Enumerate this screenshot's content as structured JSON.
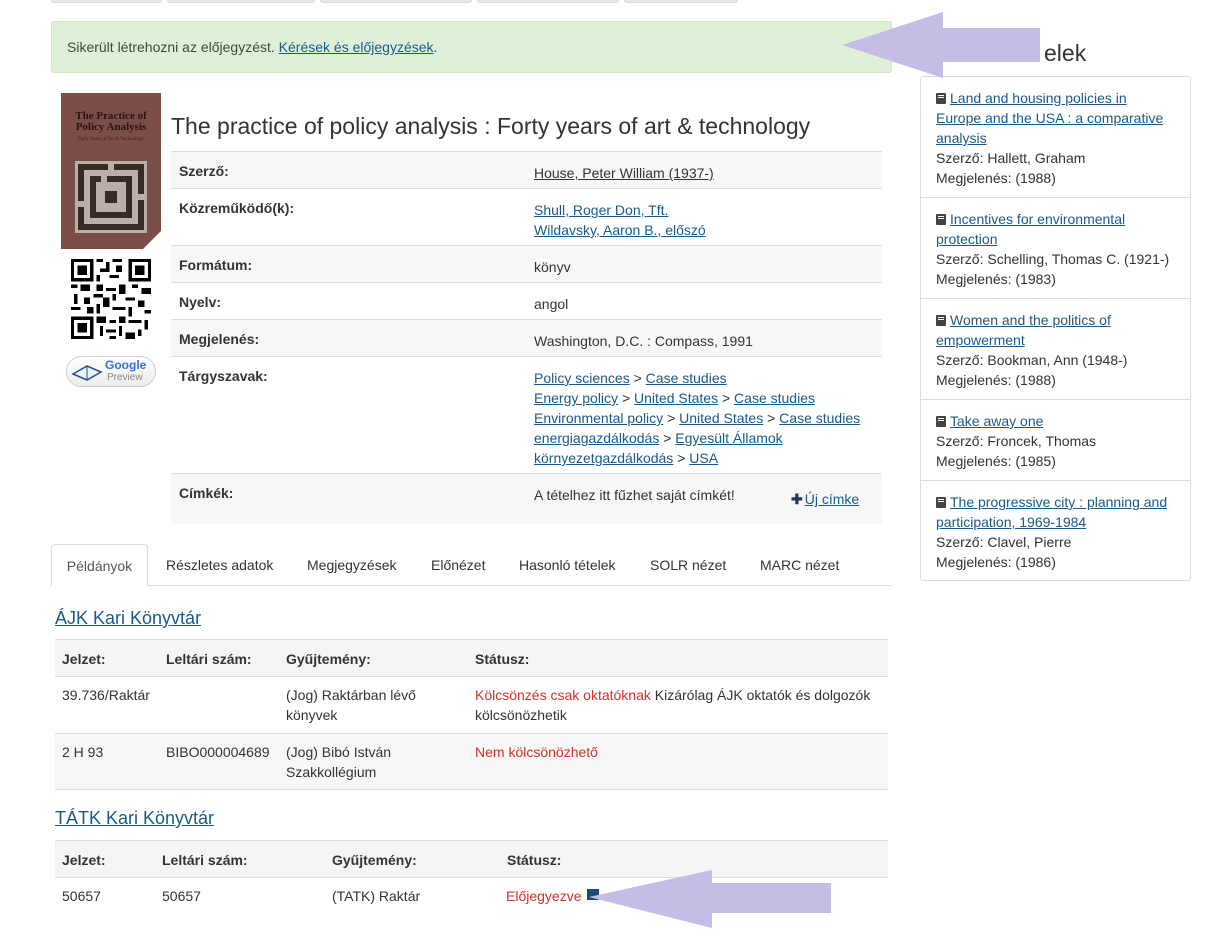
{
  "alert": {
    "message": "Sikerült létrehozni az előjegyzést.",
    "link": "Kérések és előjegyzések",
    "suffix": "."
  },
  "cover": {
    "title": "The Practice of Policy Analysis",
    "subtitle": "Forty Years of Art & Technology"
  },
  "google_preview": {
    "line1": "Google",
    "line2": "Preview"
  },
  "record": {
    "title": "The practice of policy analysis : Forty years of art & technology",
    "labels": {
      "author": "Szerző:",
      "contributors": "Közreműködő(k):",
      "format": "Formátum:",
      "language": "Nyelv:",
      "published": "Megjelenés:",
      "subjects": "Tárgyszavak:",
      "tags": "Címkék:"
    },
    "author": "House, Peter William (1937-)",
    "contributors": [
      "Shull, Roger Don, Tft.",
      "Wildavsky, Aaron B., előszó"
    ],
    "format": "könyv",
    "language": "angol",
    "published": "Washington, D.C. : Compass, 1991",
    "subjects": [
      [
        "Policy sciences",
        "Case studies"
      ],
      [
        "Energy policy",
        "United States",
        "Case studies"
      ],
      [
        "Environmental policy",
        "United States",
        "Case studies"
      ],
      [
        "energiagazdálkodás",
        "Egyesült Államok"
      ],
      [
        "környezetgazdálkodás",
        "USA"
      ]
    ],
    "subject_separator": ">",
    "tags_text": "A tételhez itt fűzhet saját címkét!",
    "new_tag": "Új címke"
  },
  "tabs": [
    "Példányok",
    "Részletes adatok",
    "Megjegyzések",
    "Előnézet",
    "Hasonló tételek",
    "SOLR nézet",
    "MARC nézet"
  ],
  "holdings": [
    {
      "library": "ÁJK Kari Könyvtár",
      "headers": [
        "Jelzet:",
        "Leltári szám:",
        "Gyűjtemény:",
        "Státusz:"
      ],
      "rows": [
        {
          "call_number": "39.736/Raktár",
          "inventory": "",
          "collection": "(Jog) Raktárban lévő könyvek",
          "status_red": "Kölcsönzés csak oktatóknak",
          "status_note": "Kizárólag ÁJK oktatók és dolgozók kölcsönözhetik"
        },
        {
          "call_number": "2 H 93",
          "inventory": "BIBO000004689",
          "collection": "(Jog) Bibó István Szakkollégium",
          "status_red": "Nem kölcsönözhető",
          "status_note": ""
        }
      ]
    },
    {
      "library": "TÁTK Kari Könyvtár",
      "headers": [
        "Jelzet:",
        "Leltári szám:",
        "Gyűjtemény:",
        "Státusz:"
      ],
      "rows": [
        {
          "call_number": "50657",
          "inventory": "50657",
          "collection": "(TATK) Raktár",
          "status_red": "Előjegyezve",
          "status_note": ""
        }
      ]
    }
  ],
  "sidebar": {
    "heading_visible": "elek",
    "items": [
      {
        "title": "Land and housing policies in Europe and the USA : a comparative analysis",
        "author_label": "Szerző:",
        "author": "Hallett, Graham",
        "date_label": "Megjelenés:",
        "date": "(1988)"
      },
      {
        "title": "Incentives for environmental protection",
        "author_label": "Szerző:",
        "author": "Schelling, Thomas C. (1921-)",
        "date_label": "Megjelenés:",
        "date": "(1983)"
      },
      {
        "title": "Women and the politics of empowerment",
        "author_label": "Szerző:",
        "author": "Bookman, Ann (1948-)",
        "date_label": "Megjelenés:",
        "date": "(1988)"
      },
      {
        "title": "Take away one",
        "author_label": "Szerző:",
        "author": "Froncek, Thomas",
        "date_label": "Megjelenés:",
        "date": "(1985)"
      },
      {
        "title": "The progressive city : planning and participation, 1969-1984",
        "author_label": "Szerző:",
        "author": "Clavel, Pierre",
        "date_label": "Megjelenés:",
        "date": "(1986)"
      }
    ]
  },
  "colors": {
    "link": "#1a5a8a",
    "alert_bg": "#dff0d8",
    "status_red": "#d0312d",
    "arrow": "#c5bde6"
  }
}
